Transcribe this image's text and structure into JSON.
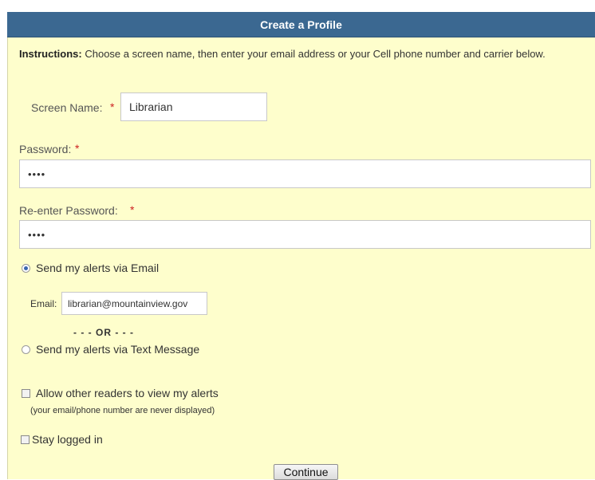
{
  "header": {
    "title": "Create a Profile"
  },
  "instructions": {
    "bold": "Instructions:",
    "text": " Choose a screen name, then enter your email address or your Cell phone number and carrier below."
  },
  "form": {
    "screen_name": {
      "label": "Screen Name:",
      "required": "*",
      "value": "Librarian"
    },
    "password": {
      "label": "Password:",
      "required": "*",
      "value": "••••"
    },
    "reenter_password": {
      "label": "Re-enter Password:",
      "required": "*",
      "value": "••••"
    },
    "alert_email": {
      "label": "Send my alerts via Email",
      "selected": true
    },
    "email": {
      "label": "Email:",
      "value": "librarian@mountainview.gov"
    },
    "or_text": "- - - OR - - -",
    "alert_text": {
      "label": "Send my alerts via Text Message",
      "selected": false
    },
    "allow_view": {
      "label": "Allow other readers to view my alerts",
      "note": "(your email/phone number are never displayed)",
      "checked": false
    },
    "stay_logged_in": {
      "label": "Stay logged in",
      "checked": false
    },
    "continue_label": "Continue"
  }
}
